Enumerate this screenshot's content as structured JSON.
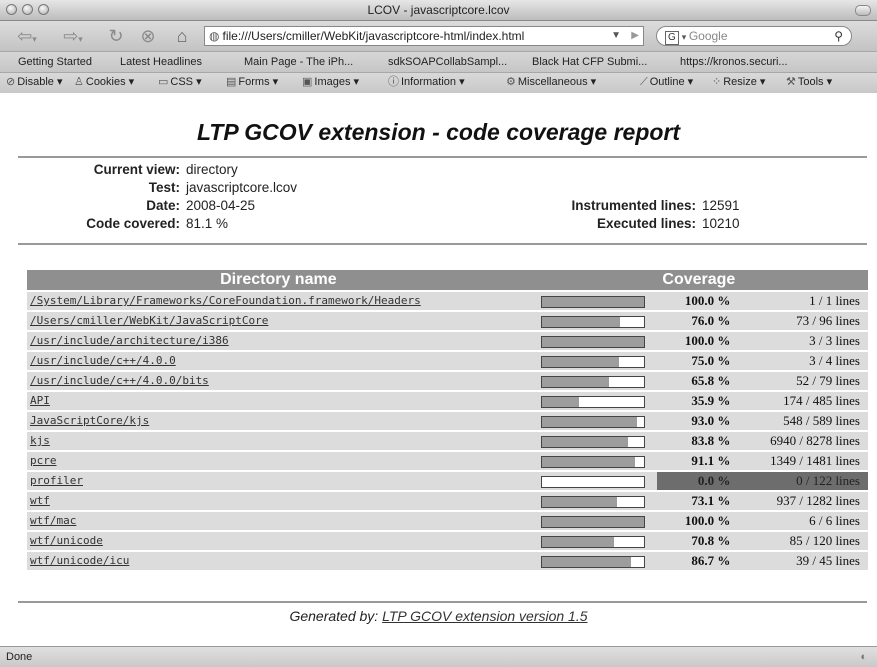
{
  "window": {
    "title": "LCOV - javascriptcore.lcov"
  },
  "toolbar": {
    "url": "file:///Users/cmiller/WebKit/javascriptcore-html/index.html",
    "search_engine": "G",
    "search_placeholder": "Google"
  },
  "bookmarks": [
    "Getting Started",
    "Latest Headlines",
    "Main Page - The iPh...",
    "sdkSOAPCollabSampl...",
    "Black Hat CFP Submi...",
    "https://kronos.securi..."
  ],
  "webdev": [
    "Disable",
    "Cookies",
    "CSS",
    "Forms",
    "Images",
    "Information",
    "Miscellaneous",
    "Outline",
    "Resize",
    "Tools"
  ],
  "report": {
    "title": "LTP GCOV extension - code coverage report",
    "current_view_label": "Current view:",
    "current_view": "directory",
    "test_label": "Test:",
    "test": "javascriptcore.lcov",
    "date_label": "Date:",
    "date": "2008-04-25",
    "code_covered_label": "Code covered:",
    "code_covered": "81.1 %",
    "instrumented_label": "Instrumented lines:",
    "instrumented": "12591",
    "executed_label": "Executed lines:",
    "executed": "10210"
  },
  "table": {
    "col_dir": "Directory name",
    "col_cov": "Coverage",
    "rows": [
      {
        "dir": "/System/Library/Frameworks/CoreFoundation.framework/Headers",
        "pct": "100.0 %",
        "lines": "1 / 1 lines",
        "ratio": 1.0
      },
      {
        "dir": "/Users/cmiller/WebKit/JavaScriptCore",
        "pct": "76.0 %",
        "lines": "73 / 96 lines",
        "ratio": 0.76
      },
      {
        "dir": "/usr/include/architecture/i386",
        "pct": "100.0 %",
        "lines": "3 / 3 lines",
        "ratio": 1.0
      },
      {
        "dir": "/usr/include/c++/4.0.0",
        "pct": "75.0 %",
        "lines": "3 / 4 lines",
        "ratio": 0.75
      },
      {
        "dir": "/usr/include/c++/4.0.0/bits",
        "pct": "65.8 %",
        "lines": "52 / 79 lines",
        "ratio": 0.658
      },
      {
        "dir": "API",
        "pct": "35.9 %",
        "lines": "174 / 485 lines",
        "ratio": 0.359
      },
      {
        "dir": "JavaScriptCore/kjs",
        "pct": "93.0 %",
        "lines": "548 / 589 lines",
        "ratio": 0.93
      },
      {
        "dir": "kjs",
        "pct": "83.8 %",
        "lines": "6940 / 8278 lines",
        "ratio": 0.838
      },
      {
        "dir": "pcre",
        "pct": "91.1 %",
        "lines": "1349 / 1481 lines",
        "ratio": 0.911
      },
      {
        "dir": "profiler",
        "pct": "0.0 %",
        "lines": "0 / 122 lines",
        "ratio": 0.0,
        "low": true
      },
      {
        "dir": "wtf",
        "pct": "73.1 %",
        "lines": "937 / 1282 lines",
        "ratio": 0.731
      },
      {
        "dir": "wtf/mac",
        "pct": "100.0 %",
        "lines": "6 / 6 lines",
        "ratio": 1.0
      },
      {
        "dir": "wtf/unicode",
        "pct": "70.8 %",
        "lines": "85 / 120 lines",
        "ratio": 0.708
      },
      {
        "dir": "wtf/unicode/icu",
        "pct": "86.7 %",
        "lines": "39 / 45 lines",
        "ratio": 0.867
      }
    ]
  },
  "footer": {
    "prefix": "Generated by:",
    "link": "LTP GCOV extension version 1.5"
  },
  "status": {
    "text": "Done"
  }
}
